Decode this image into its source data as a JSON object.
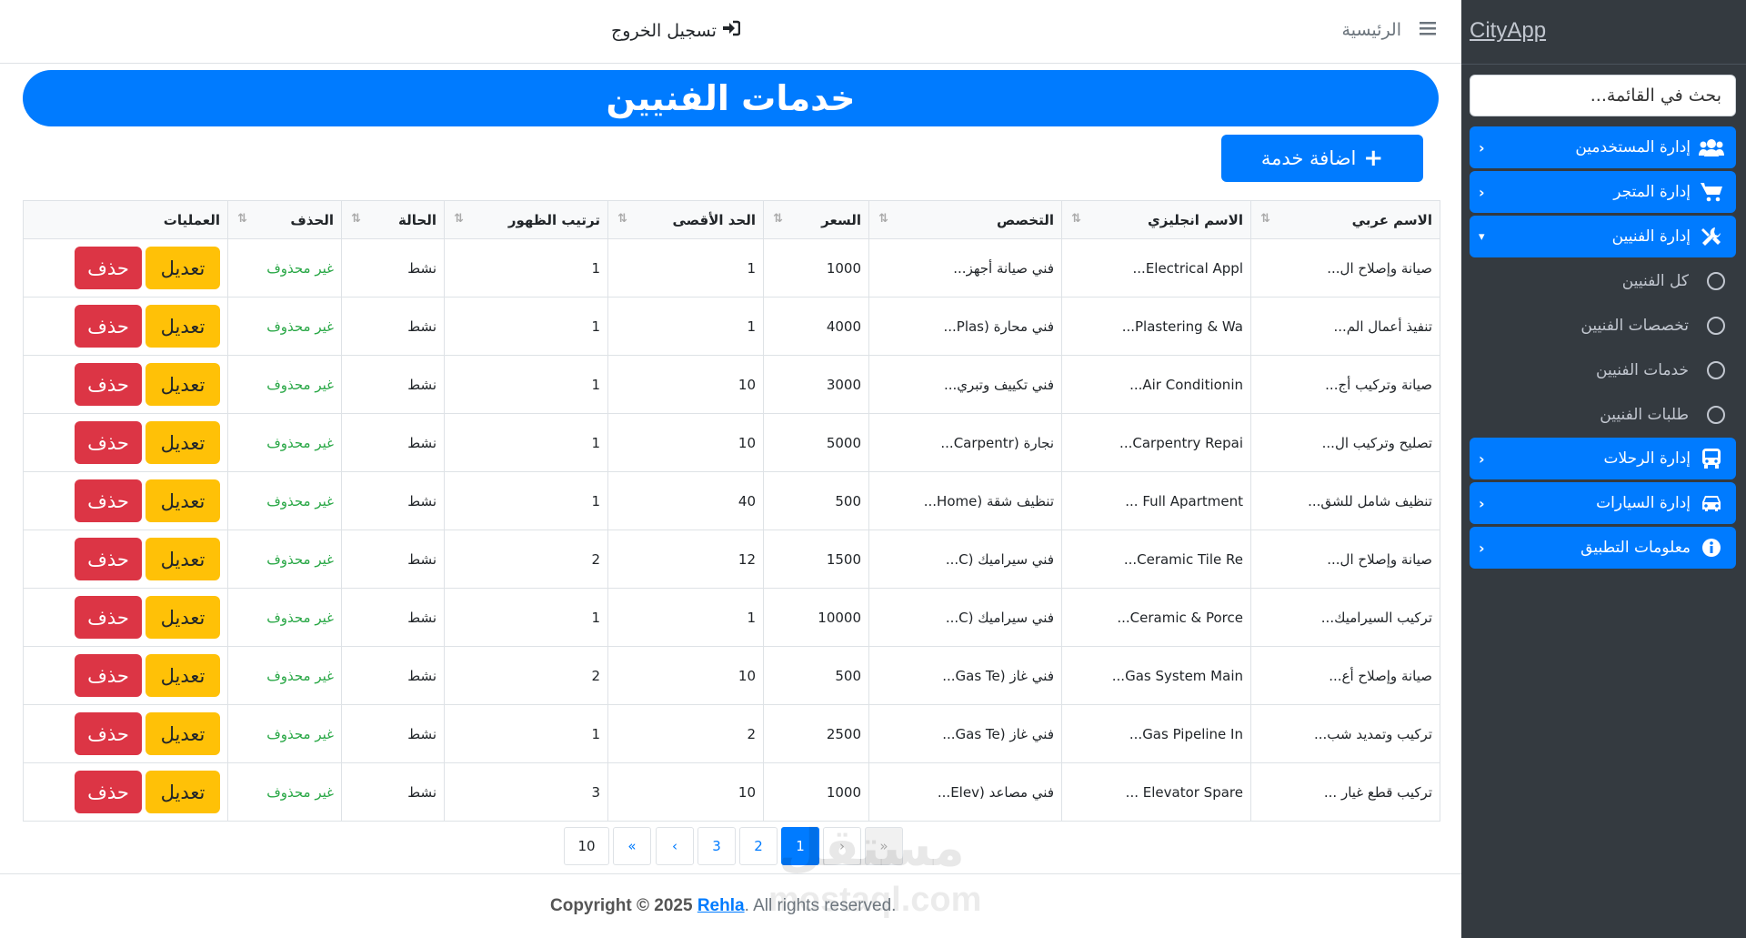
{
  "sidebar": {
    "brand": "CityApp",
    "search_placeholder": "بحث في القائمة...",
    "nav": [
      {
        "label": "إدارة المستخدمين",
        "icon": "users-icon"
      },
      {
        "label": "إدارة المتجر",
        "icon": "cart-icon"
      },
      {
        "label": "إدارة الفنيين",
        "icon": "tools-icon"
      },
      {
        "label": "إدارة الرحلات",
        "icon": "bus-icon"
      },
      {
        "label": "إدارة السيارات",
        "icon": "car-icon"
      },
      {
        "label": "معلومات التطبيق",
        "icon": "info-icon"
      }
    ],
    "subitems": [
      "كل الفنيين",
      "تخصصات الفنيين",
      "خدمات الفنيين",
      "طلبات الفنيين"
    ]
  },
  "header": {
    "home": "الرئيسية",
    "logout": "تسجيل الخروج"
  },
  "page": {
    "title": "خدمات الفنيين",
    "add_button": "اضافة خدمة"
  },
  "table": {
    "columns": [
      "الاسم عربي",
      "الاسم انجليزي",
      "التخصص",
      "السعر",
      "الحد الأقصى",
      "ترتيب الظهور",
      "الحالة",
      "الحذف",
      "العمليات"
    ],
    "edit_label": "تعديل",
    "delete_label": "حذف",
    "rows": [
      [
        "صيانة وإصلاح ال...",
        "Electrical Appl...",
        "فني صيانة أجهز...",
        "1000",
        "1",
        "1",
        "نشط",
        "غير محذوف"
      ],
      [
        "تنفيذ أعمال الم...",
        "Plastering & Wa...",
        "فني محارة (Plas...",
        "4000",
        "1",
        "1",
        "نشط",
        "غير محذوف"
      ],
      [
        "صيانة وتركيب أج...",
        "Air Conditionin...",
        "فني تكييف وتبري...",
        "3000",
        "10",
        "1",
        "نشط",
        "غير محذوف"
      ],
      [
        "تصليح وتركيب ال...",
        "Carpentry Repai...",
        "نجارة (Carpentr...",
        "5000",
        "10",
        "1",
        "نشط",
        "غير محذوف"
      ],
      [
        "تنظيف شامل للشق...",
        "Full Apartment ...",
        "تنظيف شقة (Home...",
        "500",
        "40",
        "1",
        "نشط",
        "غير محذوف"
      ],
      [
        "صيانة وإصلاح ال...",
        "Ceramic Tile Re...",
        "فني سيراميك (C...",
        "1500",
        "12",
        "2",
        "نشط",
        "غير محذوف"
      ],
      [
        "تركيب السيراميك...",
        "Ceramic & Porce...",
        "فني سيراميك (C...",
        "10000",
        "1",
        "1",
        "نشط",
        "غير محذوف"
      ],
      [
        "صيانة وإصلاح أع...",
        "Gas System Main...",
        "فني غاز (Gas Te...",
        "500",
        "10",
        "2",
        "نشط",
        "غير محذوف"
      ],
      [
        "تركيب وتمديد شب...",
        "Gas Pipeline In...",
        "فني غاز (Gas Te...",
        "2500",
        "2",
        "1",
        "نشط",
        "غير محذوف"
      ],
      [
        "تركيب قطع غيار ...",
        "Elevator Spare ...",
        "فني مصاعد (Elev...",
        "1000",
        "10",
        "3",
        "نشط",
        "غير محذوف"
      ]
    ]
  },
  "pagination": {
    "pages": [
      "«",
      "‹",
      "1",
      "2",
      "3",
      "›",
      "»",
      "10"
    ],
    "current": "1"
  },
  "footer": {
    "prefix": "Copyright © 2025 ",
    "link": "Rehla",
    "suffix": ". All rights reserved."
  },
  "watermark": {
    "arabic": "مستقل",
    "latin": "mostaql.com"
  }
}
